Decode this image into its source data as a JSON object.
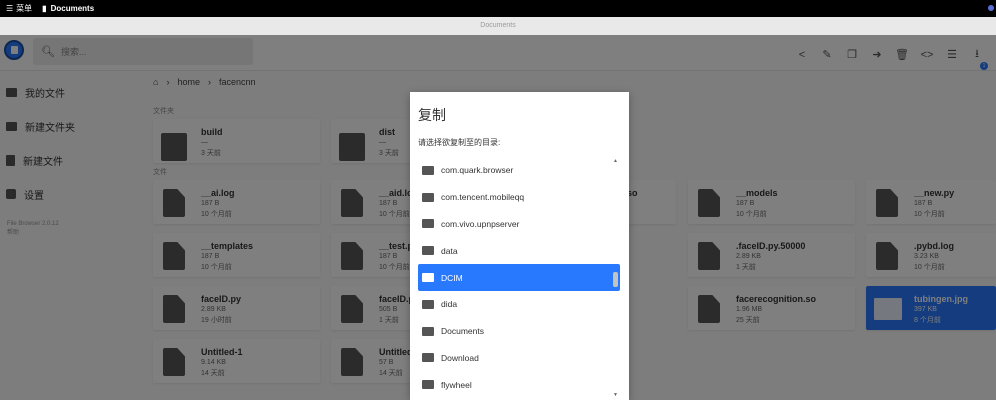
{
  "system_bar": {
    "menu_label": "菜单",
    "doc_label": "Documents"
  },
  "window_title": "Documents",
  "header": {
    "search_placeholder": "搜索...",
    "toolbar_icons": [
      "share-icon",
      "edit-icon",
      "copy-icon",
      "move-icon",
      "delete-icon",
      "code-icon",
      "list-view-icon",
      "download-icon"
    ],
    "upload_badge": "1"
  },
  "sidebar": {
    "items": [
      {
        "label": "我的文件",
        "icon": "folder-icon"
      },
      {
        "label": "新建文件夹",
        "icon": "new-folder-icon"
      },
      {
        "label": "新建文件",
        "icon": "new-file-icon"
      },
      {
        "label": "设置",
        "icon": "settings-icon"
      }
    ],
    "version": "File Browser 2.0.12",
    "help": "帮助"
  },
  "breadcrumb": [
    "home",
    "facencnn"
  ],
  "sections": {
    "folders": "文件夹",
    "files": "文件"
  },
  "folders": [
    {
      "name": "build",
      "size": "—",
      "date": "3 天前"
    },
    {
      "name": "dist",
      "size": "—",
      "date": "3 天前"
    }
  ],
  "files": [
    {
      "name": "__ai.log",
      "size": "187 B",
      "date": "10 个月前"
    },
    {
      "name": "__aid.log",
      "size": "187 B",
      "date": "10 个月前"
    },
    {
      "name": "so",
      "size": "",
      "date": ""
    },
    {
      "name": "__models",
      "size": "187 B",
      "date": "10 个月前"
    },
    {
      "name": "__new.py",
      "size": "187 B",
      "date": "10 个月前"
    },
    {
      "name": "__templates",
      "size": "187 B",
      "date": "10 个月前"
    },
    {
      "name": "__test.p",
      "size": "187 B",
      "date": "10 个月前"
    },
    {
      "name": ".faceID.py.50000",
      "size": "2.89 KB",
      "date": "1 天前"
    },
    {
      "name": ".pybd.log",
      "size": "3.23 KB",
      "date": "10 个月前"
    },
    {
      "name": "faceID.py",
      "size": "2.89 KB",
      "date": "19 小时前"
    },
    {
      "name": "faceID.p",
      "size": "505 B",
      "date": "1 天前"
    },
    {
      "name": "facerecognition.so",
      "size": "1.96 MB",
      "date": "25 天前"
    },
    {
      "name": "tubingen.jpg",
      "size": "397 KB",
      "date": "8 个月前"
    },
    {
      "name": "Untitled-1",
      "size": "9.14 KB",
      "date": "14 天前"
    },
    {
      "name": "Untitled",
      "size": "57 B",
      "date": "14 天前"
    }
  ],
  "dialog": {
    "title": "复制",
    "prompt": "请选择欲复制至的目录:",
    "dirs": [
      "com.quark.browser",
      "com.tencent.mobileqq",
      "com.vivo.upnpserver",
      "data",
      "DCIM",
      "dida",
      "Documents",
      "Download",
      "flywheel"
    ],
    "selected_index": 4
  }
}
